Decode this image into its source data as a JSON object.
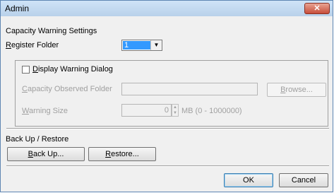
{
  "window": {
    "title": "Admin",
    "close_glyph": "✕"
  },
  "capacity": {
    "heading": "Capacity Warning Settings",
    "register_folder_label_first": "R",
    "register_folder_label_rest": "egister Folder",
    "register_folder_value": "1",
    "dropdown_arrow": "▼"
  },
  "warning_group": {
    "display_dialog_label_first": "D",
    "display_dialog_label_rest": "isplay Warning Dialog",
    "display_dialog_checked": false,
    "observed_folder_label_first": "C",
    "observed_folder_label_rest": "apacity Observed Folder",
    "observed_folder_value": "",
    "browse_label_first": "B",
    "browse_label_rest": "rowse...",
    "warning_size_label_first": "W",
    "warning_size_label_rest": "arning Size",
    "warning_size_value": "0",
    "warning_size_unit": "MB (0 - 1000000)",
    "spin_up": "▲",
    "spin_down": "▼"
  },
  "backup": {
    "heading": "Back Up / Restore",
    "backup_label_first": "B",
    "backup_label_rest": "ack Up...",
    "restore_label_first": "R",
    "restore_label_rest": "estore..."
  },
  "footer": {
    "ok_label": "OK",
    "cancel_label": "Cancel"
  }
}
